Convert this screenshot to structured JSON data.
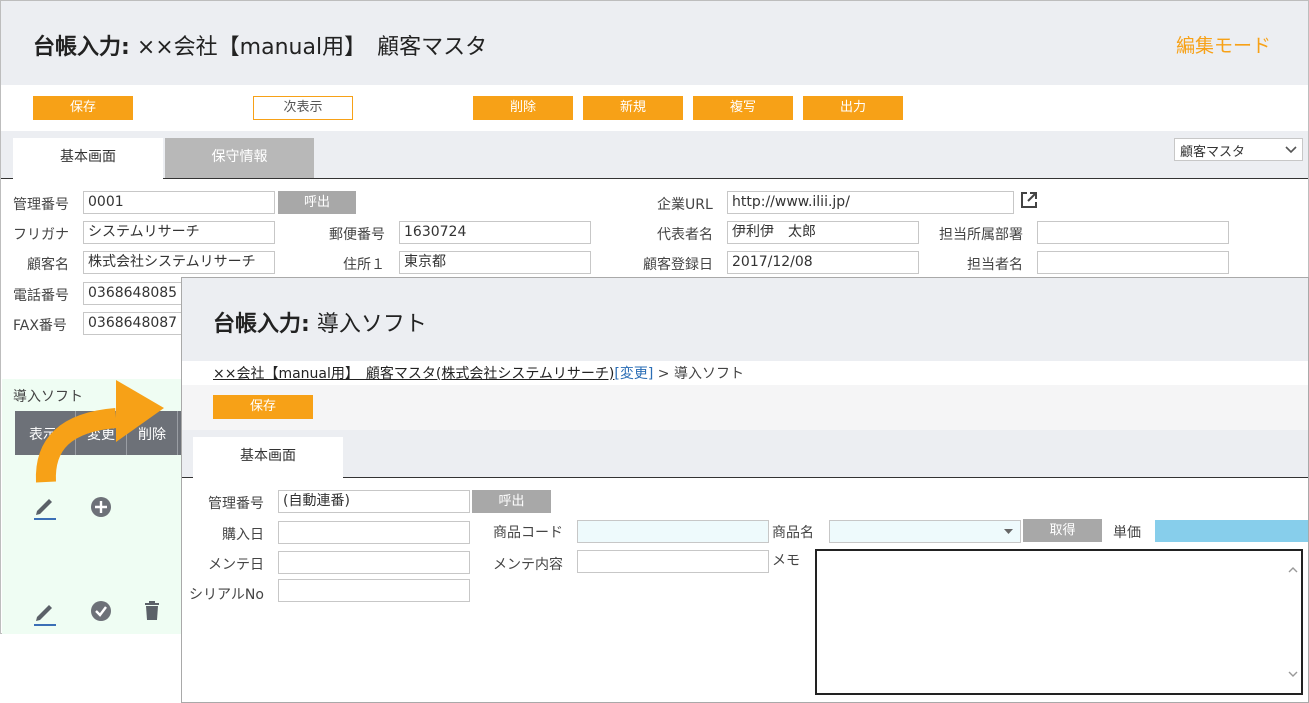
{
  "back": {
    "title_prefix": "台帳入力:",
    "title_rest": "××会社【manual用】　顧客マスタ",
    "mode": "編集モード",
    "buttons": {
      "save": "保存",
      "next": "次表示",
      "delete": "削除",
      "new": "新規",
      "copy": "複写",
      "output": "出力"
    },
    "tabs": [
      "基本画面",
      "保守情報"
    ],
    "select_value": "顧客マスタ",
    "fields": {
      "mgmt_no_label": "管理番号",
      "mgmt_no": "0001",
      "call_btn": "呼出",
      "kana_label": "フリガナ",
      "kana": "システムリサーチ",
      "name_label": "顧客名",
      "name": "株式会社システムリサーチ",
      "tel_label": "電話番号",
      "tel": "0368648085",
      "fax_label": "FAX番号",
      "fax": "0368648087",
      "zip_label": "郵便番号",
      "zip": "1630724",
      "addr_label": "住所１",
      "addr": "東京都",
      "url_label": "企業URL",
      "url": "http://www.ilii.jp/",
      "rep_label": "代表者名",
      "rep": "伊利伊　太郎",
      "reg_label": "顧客登録日",
      "reg": "2017/12/08",
      "dept_label": "担当所属部署",
      "dept": "",
      "person_label": "担当者名",
      "person": ""
    },
    "sub_section": {
      "title": "導入ソフト",
      "headers": [
        "表示",
        "変更",
        "削除"
      ]
    }
  },
  "front": {
    "title_prefix": "台帳入力:",
    "title_rest": "導入ソフト",
    "breadcrumb": {
      "link": "××会社【manual用】　顧客マスタ(株式会社システムリサーチ)",
      "change": "[変更]",
      "rest": " > 導入ソフト"
    },
    "save": "保存",
    "tab": "基本画面",
    "fields": {
      "mgmt_no_label": "管理番号",
      "mgmt_no": "(自動連番)",
      "call_btn": "呼出",
      "purchase_label": "購入日",
      "purchase": "",
      "maint_date_label": "メンテ日",
      "maint_date": "",
      "serial_label": "シリアルNo",
      "serial": "",
      "product_code_label": "商品コード",
      "product_code": "",
      "maint_content_label": "メンテ内容",
      "maint_content": "",
      "product_name_label": "商品名",
      "product_name": "",
      "get_btn": "取得",
      "price_label": "単価",
      "memo_label": "メモ",
      "memo": ""
    }
  },
  "colors": {
    "orange": "#f7a117",
    "header_bg": "#eceef2",
    "gray_button": "#a8a8a8",
    "table_header": "#6d7178",
    "light_cyan": "#eefafc",
    "price_blue": "#87ceeb"
  }
}
